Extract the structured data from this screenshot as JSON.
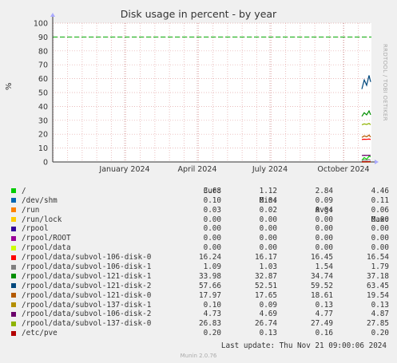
{
  "title": "Disk usage in percent - by year",
  "side_label": "RRDTOOL / TOBI OETIKER",
  "footer": "Munin 2.0.76",
  "last_update": "Last update: Thu Nov 21 09:00:06 2024",
  "legend_headers": {
    "cur": "Cur:",
    "min": "Min:",
    "avg": "Avg:",
    "max": "Max:"
  },
  "chart_data": {
    "type": "line",
    "title": "Disk usage in percent - by year",
    "ylabel": "%",
    "ylim": [
      0,
      100
    ],
    "yticks": [
      0,
      10,
      20,
      30,
      40,
      50,
      60,
      70,
      80,
      90,
      100
    ],
    "xticks": [
      "January 2024",
      "April 2024",
      "July 2024",
      "October 2024"
    ],
    "grid": true,
    "warning_line": 90,
    "colors": {
      "warning": "#00aa00",
      "grid": "#e2a6a6",
      "axis": "#333333"
    },
    "series": [
      {
        "name": "/",
        "color": "#00cc00",
        "cur": "3.68",
        "min": "1.12",
        "avg": "2.84",
        "max": "4.46"
      },
      {
        "name": "/dev/shm",
        "color": "#0066b3",
        "cur": "0.10",
        "min": "0.04",
        "avg": "0.09",
        "max": "0.11"
      },
      {
        "name": "/run",
        "color": "#ff8000",
        "cur": "0.03",
        "min": "0.02",
        "avg": "0.04",
        "max": "0.06"
      },
      {
        "name": "/run/lock",
        "color": "#ffcc00",
        "cur": "0.00",
        "min": "0.00",
        "avg": "0.00",
        "max": "0.00"
      },
      {
        "name": "/rpool",
        "color": "#330099",
        "cur": "0.00",
        "min": "0.00",
        "avg": "0.00",
        "max": "0.00"
      },
      {
        "name": "/rpool/ROOT",
        "color": "#990099",
        "cur": "0.00",
        "min": "0.00",
        "avg": "0.00",
        "max": "0.00"
      },
      {
        "name": "/rpool/data",
        "color": "#ccff00",
        "cur": "0.00",
        "min": "0.00",
        "avg": "0.00",
        "max": "0.00"
      },
      {
        "name": "/rpool/data/subvol-106-disk-0",
        "color": "#ff0000",
        "cur": "16.24",
        "min": "16.17",
        "avg": "16.45",
        "max": "16.54"
      },
      {
        "name": "/rpool/data/subvol-106-disk-1",
        "color": "#808080",
        "cur": "1.09",
        "min": "1.03",
        "avg": "1.54",
        "max": "1.79"
      },
      {
        "name": "/rpool/data/subvol-121-disk-1",
        "color": "#008f00",
        "cur": "33.98",
        "min": "32.87",
        "avg": "34.74",
        "max": "37.18"
      },
      {
        "name": "/rpool/data/subvol-121-disk-2",
        "color": "#00487d",
        "cur": "57.66",
        "min": "52.51",
        "avg": "59.52",
        "max": "63.45"
      },
      {
        "name": "/rpool/data/subvol-121-disk-0",
        "color": "#b35a00",
        "cur": "17.97",
        "min": "17.65",
        "avg": "18.61",
        "max": "19.54"
      },
      {
        "name": "/rpool/data/subvol-137-disk-1",
        "color": "#b38f00",
        "cur": "0.10",
        "min": "0.09",
        "avg": "0.13",
        "max": "0.13"
      },
      {
        "name": "/rpool/data/subvol-106-disk-2",
        "color": "#6b006b",
        "cur": "4.73",
        "min": "4.69",
        "avg": "4.77",
        "max": "4.87"
      },
      {
        "name": "/rpool/data/subvol-137-disk-0",
        "color": "#8fb300",
        "cur": "26.83",
        "min": "26.74",
        "avg": "27.49",
        "max": "27.85"
      },
      {
        "name": "/etc/pve",
        "color": "#b30000",
        "cur": "0.20",
        "min": "0.13",
        "avg": "0.16",
        "max": "0.20"
      }
    ]
  }
}
